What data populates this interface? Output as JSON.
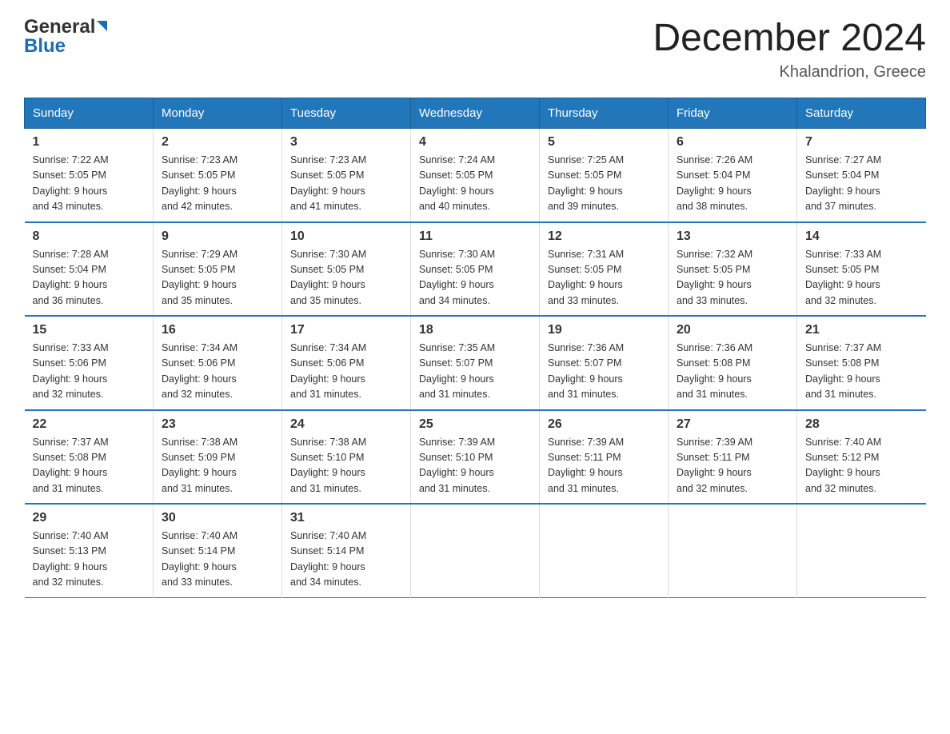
{
  "header": {
    "logo_general": "General",
    "logo_blue": "Blue",
    "title": "December 2024",
    "location": "Khalandrion, Greece"
  },
  "days_of_week": [
    "Sunday",
    "Monday",
    "Tuesday",
    "Wednesday",
    "Thursday",
    "Friday",
    "Saturday"
  ],
  "weeks": [
    [
      {
        "day": "1",
        "sunrise": "7:22 AM",
        "sunset": "5:05 PM",
        "daylight": "9 hours and 43 minutes."
      },
      {
        "day": "2",
        "sunrise": "7:23 AM",
        "sunset": "5:05 PM",
        "daylight": "9 hours and 42 minutes."
      },
      {
        "day": "3",
        "sunrise": "7:23 AM",
        "sunset": "5:05 PM",
        "daylight": "9 hours and 41 minutes."
      },
      {
        "day": "4",
        "sunrise": "7:24 AM",
        "sunset": "5:05 PM",
        "daylight": "9 hours and 40 minutes."
      },
      {
        "day": "5",
        "sunrise": "7:25 AM",
        "sunset": "5:05 PM",
        "daylight": "9 hours and 39 minutes."
      },
      {
        "day": "6",
        "sunrise": "7:26 AM",
        "sunset": "5:04 PM",
        "daylight": "9 hours and 38 minutes."
      },
      {
        "day": "7",
        "sunrise": "7:27 AM",
        "sunset": "5:04 PM",
        "daylight": "9 hours and 37 minutes."
      }
    ],
    [
      {
        "day": "8",
        "sunrise": "7:28 AM",
        "sunset": "5:04 PM",
        "daylight": "9 hours and 36 minutes."
      },
      {
        "day": "9",
        "sunrise": "7:29 AM",
        "sunset": "5:05 PM",
        "daylight": "9 hours and 35 minutes."
      },
      {
        "day": "10",
        "sunrise": "7:30 AM",
        "sunset": "5:05 PM",
        "daylight": "9 hours and 35 minutes."
      },
      {
        "day": "11",
        "sunrise": "7:30 AM",
        "sunset": "5:05 PM",
        "daylight": "9 hours and 34 minutes."
      },
      {
        "day": "12",
        "sunrise": "7:31 AM",
        "sunset": "5:05 PM",
        "daylight": "9 hours and 33 minutes."
      },
      {
        "day": "13",
        "sunrise": "7:32 AM",
        "sunset": "5:05 PM",
        "daylight": "9 hours and 33 minutes."
      },
      {
        "day": "14",
        "sunrise": "7:33 AM",
        "sunset": "5:05 PM",
        "daylight": "9 hours and 32 minutes."
      }
    ],
    [
      {
        "day": "15",
        "sunrise": "7:33 AM",
        "sunset": "5:06 PM",
        "daylight": "9 hours and 32 minutes."
      },
      {
        "day": "16",
        "sunrise": "7:34 AM",
        "sunset": "5:06 PM",
        "daylight": "9 hours and 32 minutes."
      },
      {
        "day": "17",
        "sunrise": "7:34 AM",
        "sunset": "5:06 PM",
        "daylight": "9 hours and 31 minutes."
      },
      {
        "day": "18",
        "sunrise": "7:35 AM",
        "sunset": "5:07 PM",
        "daylight": "9 hours and 31 minutes."
      },
      {
        "day": "19",
        "sunrise": "7:36 AM",
        "sunset": "5:07 PM",
        "daylight": "9 hours and 31 minutes."
      },
      {
        "day": "20",
        "sunrise": "7:36 AM",
        "sunset": "5:08 PM",
        "daylight": "9 hours and 31 minutes."
      },
      {
        "day": "21",
        "sunrise": "7:37 AM",
        "sunset": "5:08 PM",
        "daylight": "9 hours and 31 minutes."
      }
    ],
    [
      {
        "day": "22",
        "sunrise": "7:37 AM",
        "sunset": "5:08 PM",
        "daylight": "9 hours and 31 minutes."
      },
      {
        "day": "23",
        "sunrise": "7:38 AM",
        "sunset": "5:09 PM",
        "daylight": "9 hours and 31 minutes."
      },
      {
        "day": "24",
        "sunrise": "7:38 AM",
        "sunset": "5:10 PM",
        "daylight": "9 hours and 31 minutes."
      },
      {
        "day": "25",
        "sunrise": "7:39 AM",
        "sunset": "5:10 PM",
        "daylight": "9 hours and 31 minutes."
      },
      {
        "day": "26",
        "sunrise": "7:39 AM",
        "sunset": "5:11 PM",
        "daylight": "9 hours and 31 minutes."
      },
      {
        "day": "27",
        "sunrise": "7:39 AM",
        "sunset": "5:11 PM",
        "daylight": "9 hours and 32 minutes."
      },
      {
        "day": "28",
        "sunrise": "7:40 AM",
        "sunset": "5:12 PM",
        "daylight": "9 hours and 32 minutes."
      }
    ],
    [
      {
        "day": "29",
        "sunrise": "7:40 AM",
        "sunset": "5:13 PM",
        "daylight": "9 hours and 32 minutes."
      },
      {
        "day": "30",
        "sunrise": "7:40 AM",
        "sunset": "5:14 PM",
        "daylight": "9 hours and 33 minutes."
      },
      {
        "day": "31",
        "sunrise": "7:40 AM",
        "sunset": "5:14 PM",
        "daylight": "9 hours and 34 minutes."
      },
      null,
      null,
      null,
      null
    ]
  ],
  "labels": {
    "sunrise": "Sunrise:",
    "sunset": "Sunset:",
    "daylight": "Daylight:"
  }
}
